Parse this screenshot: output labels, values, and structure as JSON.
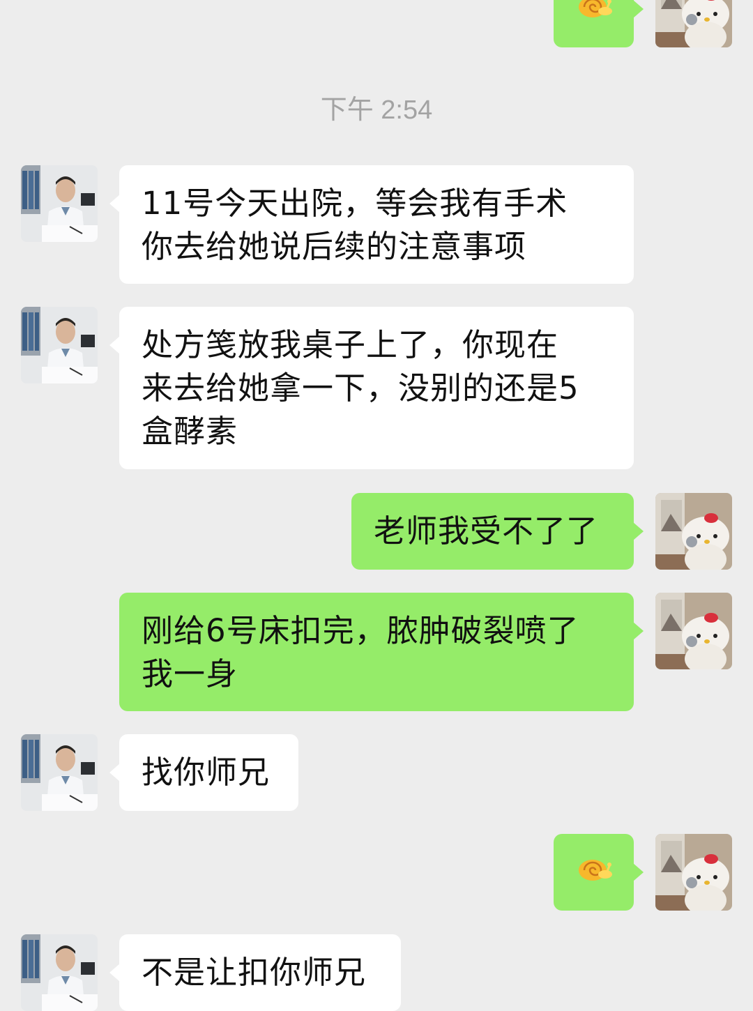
{
  "timestamp": "下午 2:54",
  "messages": [
    {
      "side": "right",
      "kind": "emoji",
      "emoji": "snail-emoji"
    },
    {
      "side": "left",
      "kind": "text",
      "text": "11号今天出院，等会我有手术\n你去给她说后续的注意事项"
    },
    {
      "side": "left",
      "kind": "text",
      "text": "处方笺放我桌子上了，你现在\n来去给她拿一下，没别的还是5\n盒酵素"
    },
    {
      "side": "right",
      "kind": "text",
      "text": "老师我受不了了"
    },
    {
      "side": "right",
      "kind": "text",
      "text": "刚给6号床扣完，脓肿破裂喷了\n我一身"
    },
    {
      "side": "left",
      "kind": "text",
      "text": "找你师兄"
    },
    {
      "side": "right",
      "kind": "emoji",
      "emoji": "snail-emoji"
    },
    {
      "side": "left",
      "kind": "text",
      "text": "不是让扣你师兄"
    }
  ],
  "colors": {
    "background": "#ededed",
    "incoming_bubble": "#ffffff",
    "outgoing_bubble": "#95ec69",
    "timestamp_text": "#a3a3a3"
  },
  "avatars": {
    "incoming": "doctor-avatar",
    "outgoing": "hello-kitty-doctor-avatar"
  }
}
